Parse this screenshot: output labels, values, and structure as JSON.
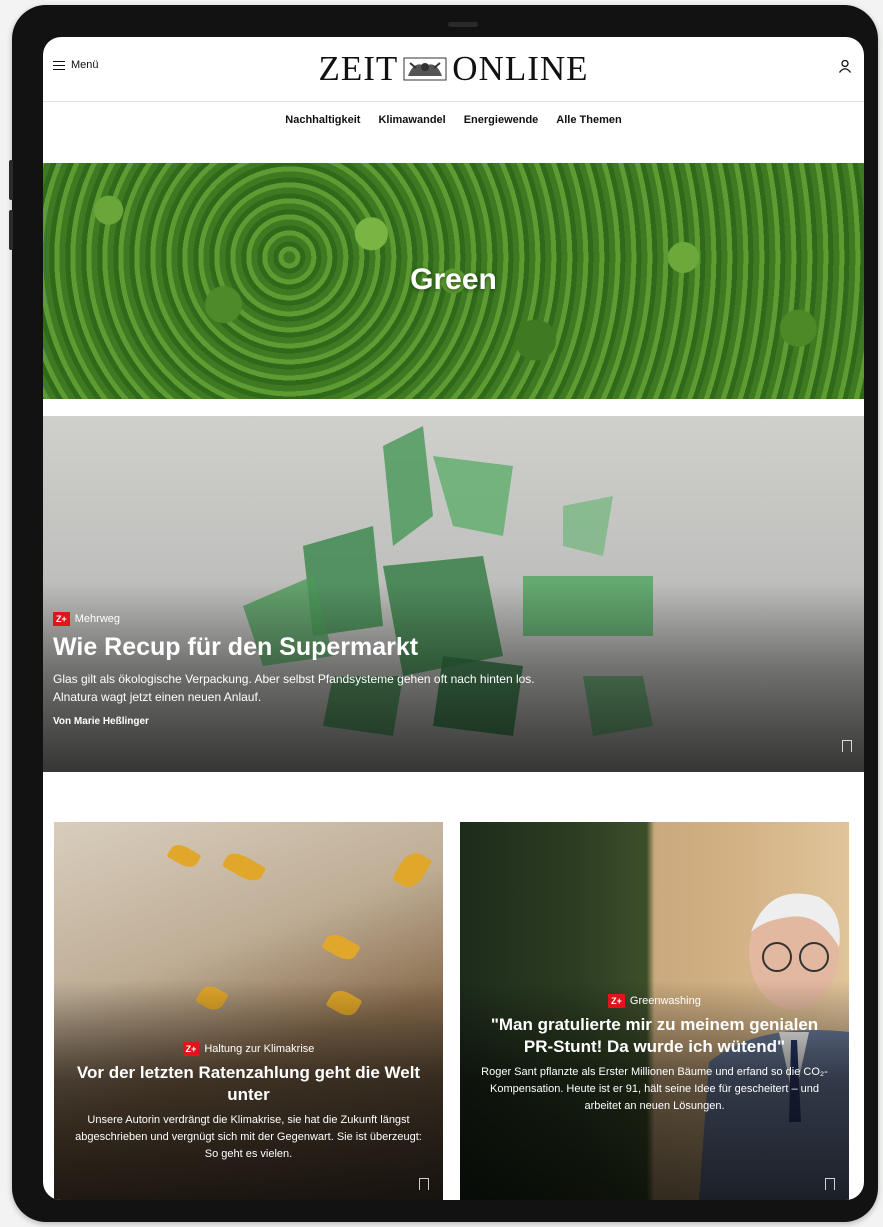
{
  "header": {
    "menu_label": "Menü",
    "logo_left": "ZEIT",
    "logo_right": "ONLINE"
  },
  "nav": [
    "Nachhaltigkeit",
    "Klimawandel",
    "Energiewende",
    "Alle Themen"
  ],
  "hero": {
    "title": "Green"
  },
  "feature": {
    "badge": "Z+",
    "kicker": "Mehrweg",
    "title": "Wie Recup für den Supermarkt",
    "summary": "Glas gilt als ökologische Verpackung. Aber selbst Pfandsysteme gehen oft nach hinten los. Alnatura wagt jetzt einen neuen Anlauf.",
    "author": "Von Marie Heßlinger"
  },
  "cards": [
    {
      "badge": "Z+",
      "kicker": "Haltung zur Klimakrise",
      "title": "Vor der letzten Ratenzahlung geht die Welt unter",
      "summary": "Unsere Autorin verdrängt die Klimakrise, sie hat die Zukunft längst abgeschrieben und vergnügt sich mit der Gegenwart. Sie ist überzeugt: So geht es vielen."
    },
    {
      "badge": "Z+",
      "kicker": "Greenwashing",
      "title": "\"Man gratulierte mir zu meinem genialen PR-Stunt! Da wurde ich wütend\"",
      "summary": "Roger Sant pflanzte als Erster Millionen Bäume und erfand so die CO₂-Kompensation. Heute ist er 91, hält seine Idee für gescheitert – und arbeitet an neuen Lösungen."
    }
  ],
  "colors": {
    "accent_red": "#e1141b",
    "forest_green": "#4a8a28"
  }
}
